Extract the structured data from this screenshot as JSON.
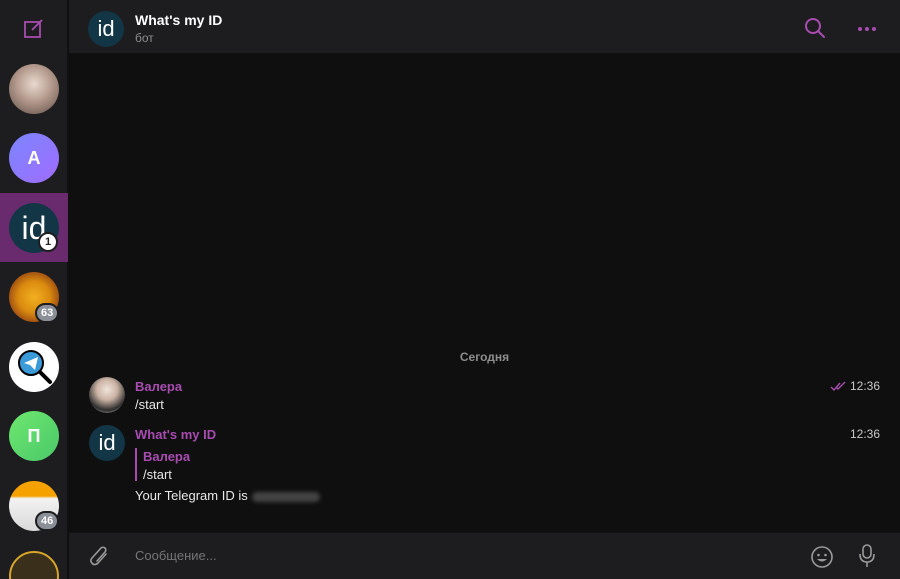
{
  "sidebar": {
    "compose_icon": "compose-icon",
    "chats": [
      {
        "id": "chat-1",
        "avatar": "photo",
        "badge": ""
      },
      {
        "id": "chat-2",
        "avatar_letter": "A",
        "badge": ""
      },
      {
        "id": "chat-3",
        "avatar_letter": "id",
        "badge": "1",
        "active": true
      },
      {
        "id": "chat-4",
        "avatar": "photo",
        "badge": "63"
      },
      {
        "id": "chat-5",
        "avatar": "telegram-search-icon",
        "badge": ""
      },
      {
        "id": "chat-6",
        "avatar_letter": "П",
        "badge": ""
      },
      {
        "id": "chat-7",
        "avatar": "photo",
        "badge": "46"
      }
    ]
  },
  "header": {
    "avatar_text": "id",
    "title": "What's my ID",
    "subtitle": "бот"
  },
  "messages": {
    "date_separator": "Сегодня",
    "items": [
      {
        "sender": "Валера",
        "text": "/start",
        "time": "12:36",
        "read": true
      },
      {
        "sender": "What's my ID",
        "avatar_text": "id",
        "reply_sender": "Валера",
        "reply_text": "/start",
        "text": "Your Telegram ID is",
        "time": "12:36"
      }
    ]
  },
  "composer": {
    "placeholder": "Сообщение..."
  },
  "colors": {
    "accent": "#a84cb0",
    "active_chat": "#6a2a6e",
    "background": "#0f0f10",
    "panel": "#1d1d1f"
  }
}
